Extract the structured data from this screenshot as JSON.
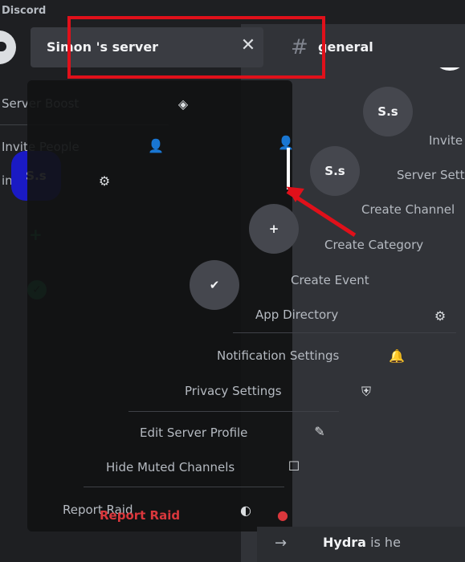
{
  "app": {
    "name": "Discord"
  },
  "server": {
    "name": "Simon 's server"
  },
  "channel": {
    "name": "general"
  },
  "icons": {
    "close": "close-icon",
    "hash": "hash-icon",
    "boost": "boost-icon",
    "invite": "invite-icon",
    "settings": "gear-icon",
    "create_channel": "plus-circle-icon",
    "create_category": "folder-plus-icon",
    "create_event": "calendar-plus-icon",
    "app_directory": "robot-icon",
    "notifications": "bell-icon",
    "privacy": "shield-icon",
    "edit_profile": "pencil-icon",
    "hide_muted": "checkbox-icon",
    "report": "alert-icon"
  },
  "avatars": {
    "server": "S.s",
    "ghost1": "S.s",
    "ghost2": "S.s"
  },
  "menu_left": {
    "boost": "Server Boost",
    "invite": "Invite People",
    "settings_partial": "ings"
  },
  "menu_right": {
    "invite": "Invite",
    "settings": "Server Setti",
    "create_channel": "Create Channel",
    "create_category": "Create Category",
    "create_event": "Create Event",
    "app_directory": "App Directory"
  },
  "menu_main": {
    "notifications": "Notification Settings",
    "privacy": "Privacy Settings",
    "edit_profile": "Edit Server Profile",
    "hide_muted": "Hide Muted Channels",
    "report_raid": "Report Raid"
  },
  "bottom": {
    "user": "Hydra",
    "text": "is he"
  },
  "colors": {
    "accent": "#e0101a",
    "avatar": "#1a1ac4",
    "danger": "#da373c",
    "online": "#23a55a"
  }
}
